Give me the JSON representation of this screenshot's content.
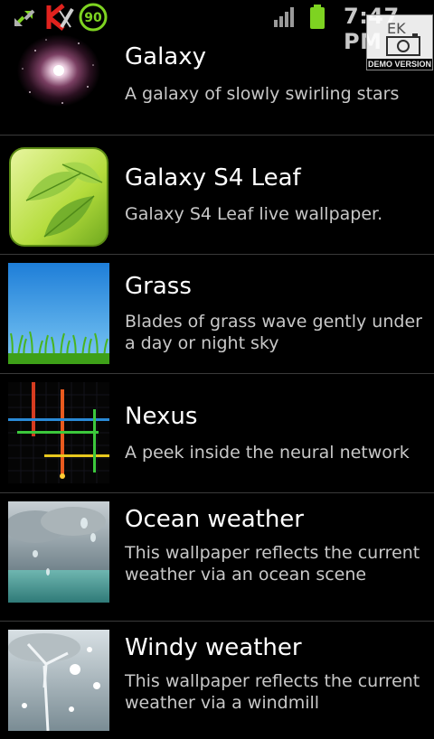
{
  "status_bar": {
    "time": "7:47 PM",
    "battery_level": "90",
    "icons": [
      "sync-arrows-icon",
      "kaspersky-k-icon",
      "battery-90-circle-icon",
      "signal-bars-icon",
      "battery-icon"
    ]
  },
  "demo_badge": {
    "label": "DEMO VERSION"
  },
  "wallpapers": [
    {
      "title": "Galaxy",
      "description": "A galaxy of slowly swirling stars",
      "thumbnail": "galaxy-thumbnail"
    },
    {
      "title": "Galaxy S4 Leaf",
      "description": "Galaxy S4 Leaf live wallpaper.",
      "thumbnail": "leaf-thumbnail"
    },
    {
      "title": "Grass",
      "description": "Blades of grass wave gently under a day or night sky",
      "thumbnail": "grass-thumbnail"
    },
    {
      "title": "Nexus",
      "description": "A peek inside the neural network",
      "thumbnail": "nexus-thumbnail"
    },
    {
      "title": "Ocean weather",
      "description": "This wallpaper reflects the current weather via an ocean scene",
      "thumbnail": "ocean-weather-thumbnail"
    },
    {
      "title": "Windy weather",
      "description": "This wallpaper reflects the current weather via a windmill",
      "thumbnail": "windy-weather-thumbnail"
    }
  ],
  "colors": {
    "background": "#000000",
    "title_text": "#ffffff",
    "description_text": "#c8c8c8",
    "divider": "#3a3a3a",
    "status_green": "#7ed321"
  }
}
